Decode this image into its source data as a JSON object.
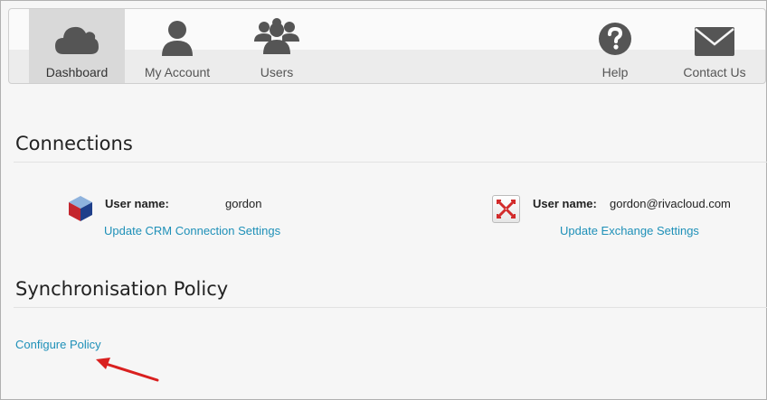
{
  "nav": {
    "items": [
      {
        "label": "Dashboard",
        "icon": "cloud-icon",
        "active": true
      },
      {
        "label": "My Account",
        "icon": "user-icon",
        "active": false
      },
      {
        "label": "Users",
        "icon": "users-group-icon",
        "active": false
      },
      {
        "label": "Help",
        "icon": "help-icon",
        "active": false
      },
      {
        "label": "Contact Us",
        "icon": "envelope-icon",
        "active": false
      }
    ]
  },
  "connections": {
    "title": "Connections",
    "crm": {
      "icon": "crm-cube-icon",
      "username_label": "User name:",
      "username": "gordon",
      "link": "Update CRM Connection Settings"
    },
    "exchange": {
      "icon": "exchange-icon",
      "username_label": "User name:",
      "username": "gordon@rivacloud.com",
      "link": "Update Exchange Settings"
    }
  },
  "sync_policy": {
    "title": "Synchronisation Policy",
    "link": "Configure Policy"
  },
  "colors": {
    "link": "#1e90b8",
    "icon_dark": "#555555",
    "annotation_arrow": "#d9201f"
  }
}
